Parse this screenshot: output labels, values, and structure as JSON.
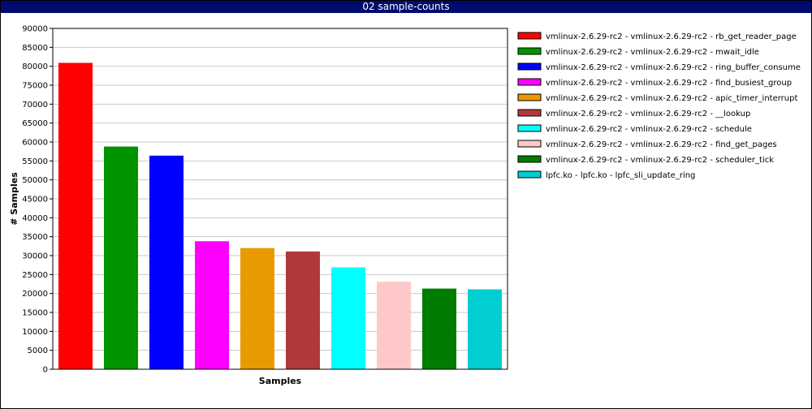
{
  "window": {
    "title": "02 sample-counts"
  },
  "chart_data": {
    "type": "bar",
    "title": "02 sample-counts",
    "xlabel": "Samples",
    "ylabel": "# Samples",
    "ylim": [
      0,
      90000
    ],
    "yticks": [
      0,
      5000,
      10000,
      15000,
      20000,
      25000,
      30000,
      35000,
      40000,
      45000,
      50000,
      55000,
      60000,
      65000,
      70000,
      75000,
      80000,
      85000,
      90000
    ],
    "grid": true,
    "legend_position": "right",
    "series": [
      {
        "name": "vmlinux-2.6.29-rc2 - vmlinux-2.6.29-rc2 - rb_get_reader_page",
        "value": 80900,
        "color": "#ff0000"
      },
      {
        "name": "vmlinux-2.6.29-rc2 - vmlinux-2.6.29-rc2 - mwait_idle",
        "value": 58800,
        "color": "#009400"
      },
      {
        "name": "vmlinux-2.6.29-rc2 - vmlinux-2.6.29-rc2 - ring_buffer_consume",
        "value": 56400,
        "color": "#0000ff"
      },
      {
        "name": "vmlinux-2.6.29-rc2 - vmlinux-2.6.29-rc2 - find_busiest_group",
        "value": 33800,
        "color": "#ff00ff"
      },
      {
        "name": "vmlinux-2.6.29-rc2 - vmlinux-2.6.29-rc2 - apic_timer_interrupt",
        "value": 32000,
        "color": "#e89a00"
      },
      {
        "name": "vmlinux-2.6.29-rc2 - vmlinux-2.6.29-rc2 - __lookup",
        "value": 31100,
        "color": "#b03a3a"
      },
      {
        "name": "vmlinux-2.6.29-rc2 - vmlinux-2.6.29-rc2 - schedule",
        "value": 26900,
        "color": "#00ffff"
      },
      {
        "name": "vmlinux-2.6.29-rc2 - vmlinux-2.6.29-rc2 - find_get_pages",
        "value": 23100,
        "color": "#ffc8c8"
      },
      {
        "name": "vmlinux-2.6.29-rc2 - vmlinux-2.6.29-rc2 - scheduler_tick",
        "value": 21300,
        "color": "#007c00"
      },
      {
        "name": "lpfc.ko - lpfc.ko - lpfc_sli_update_ring",
        "value": 21100,
        "color": "#00ced1"
      }
    ]
  }
}
